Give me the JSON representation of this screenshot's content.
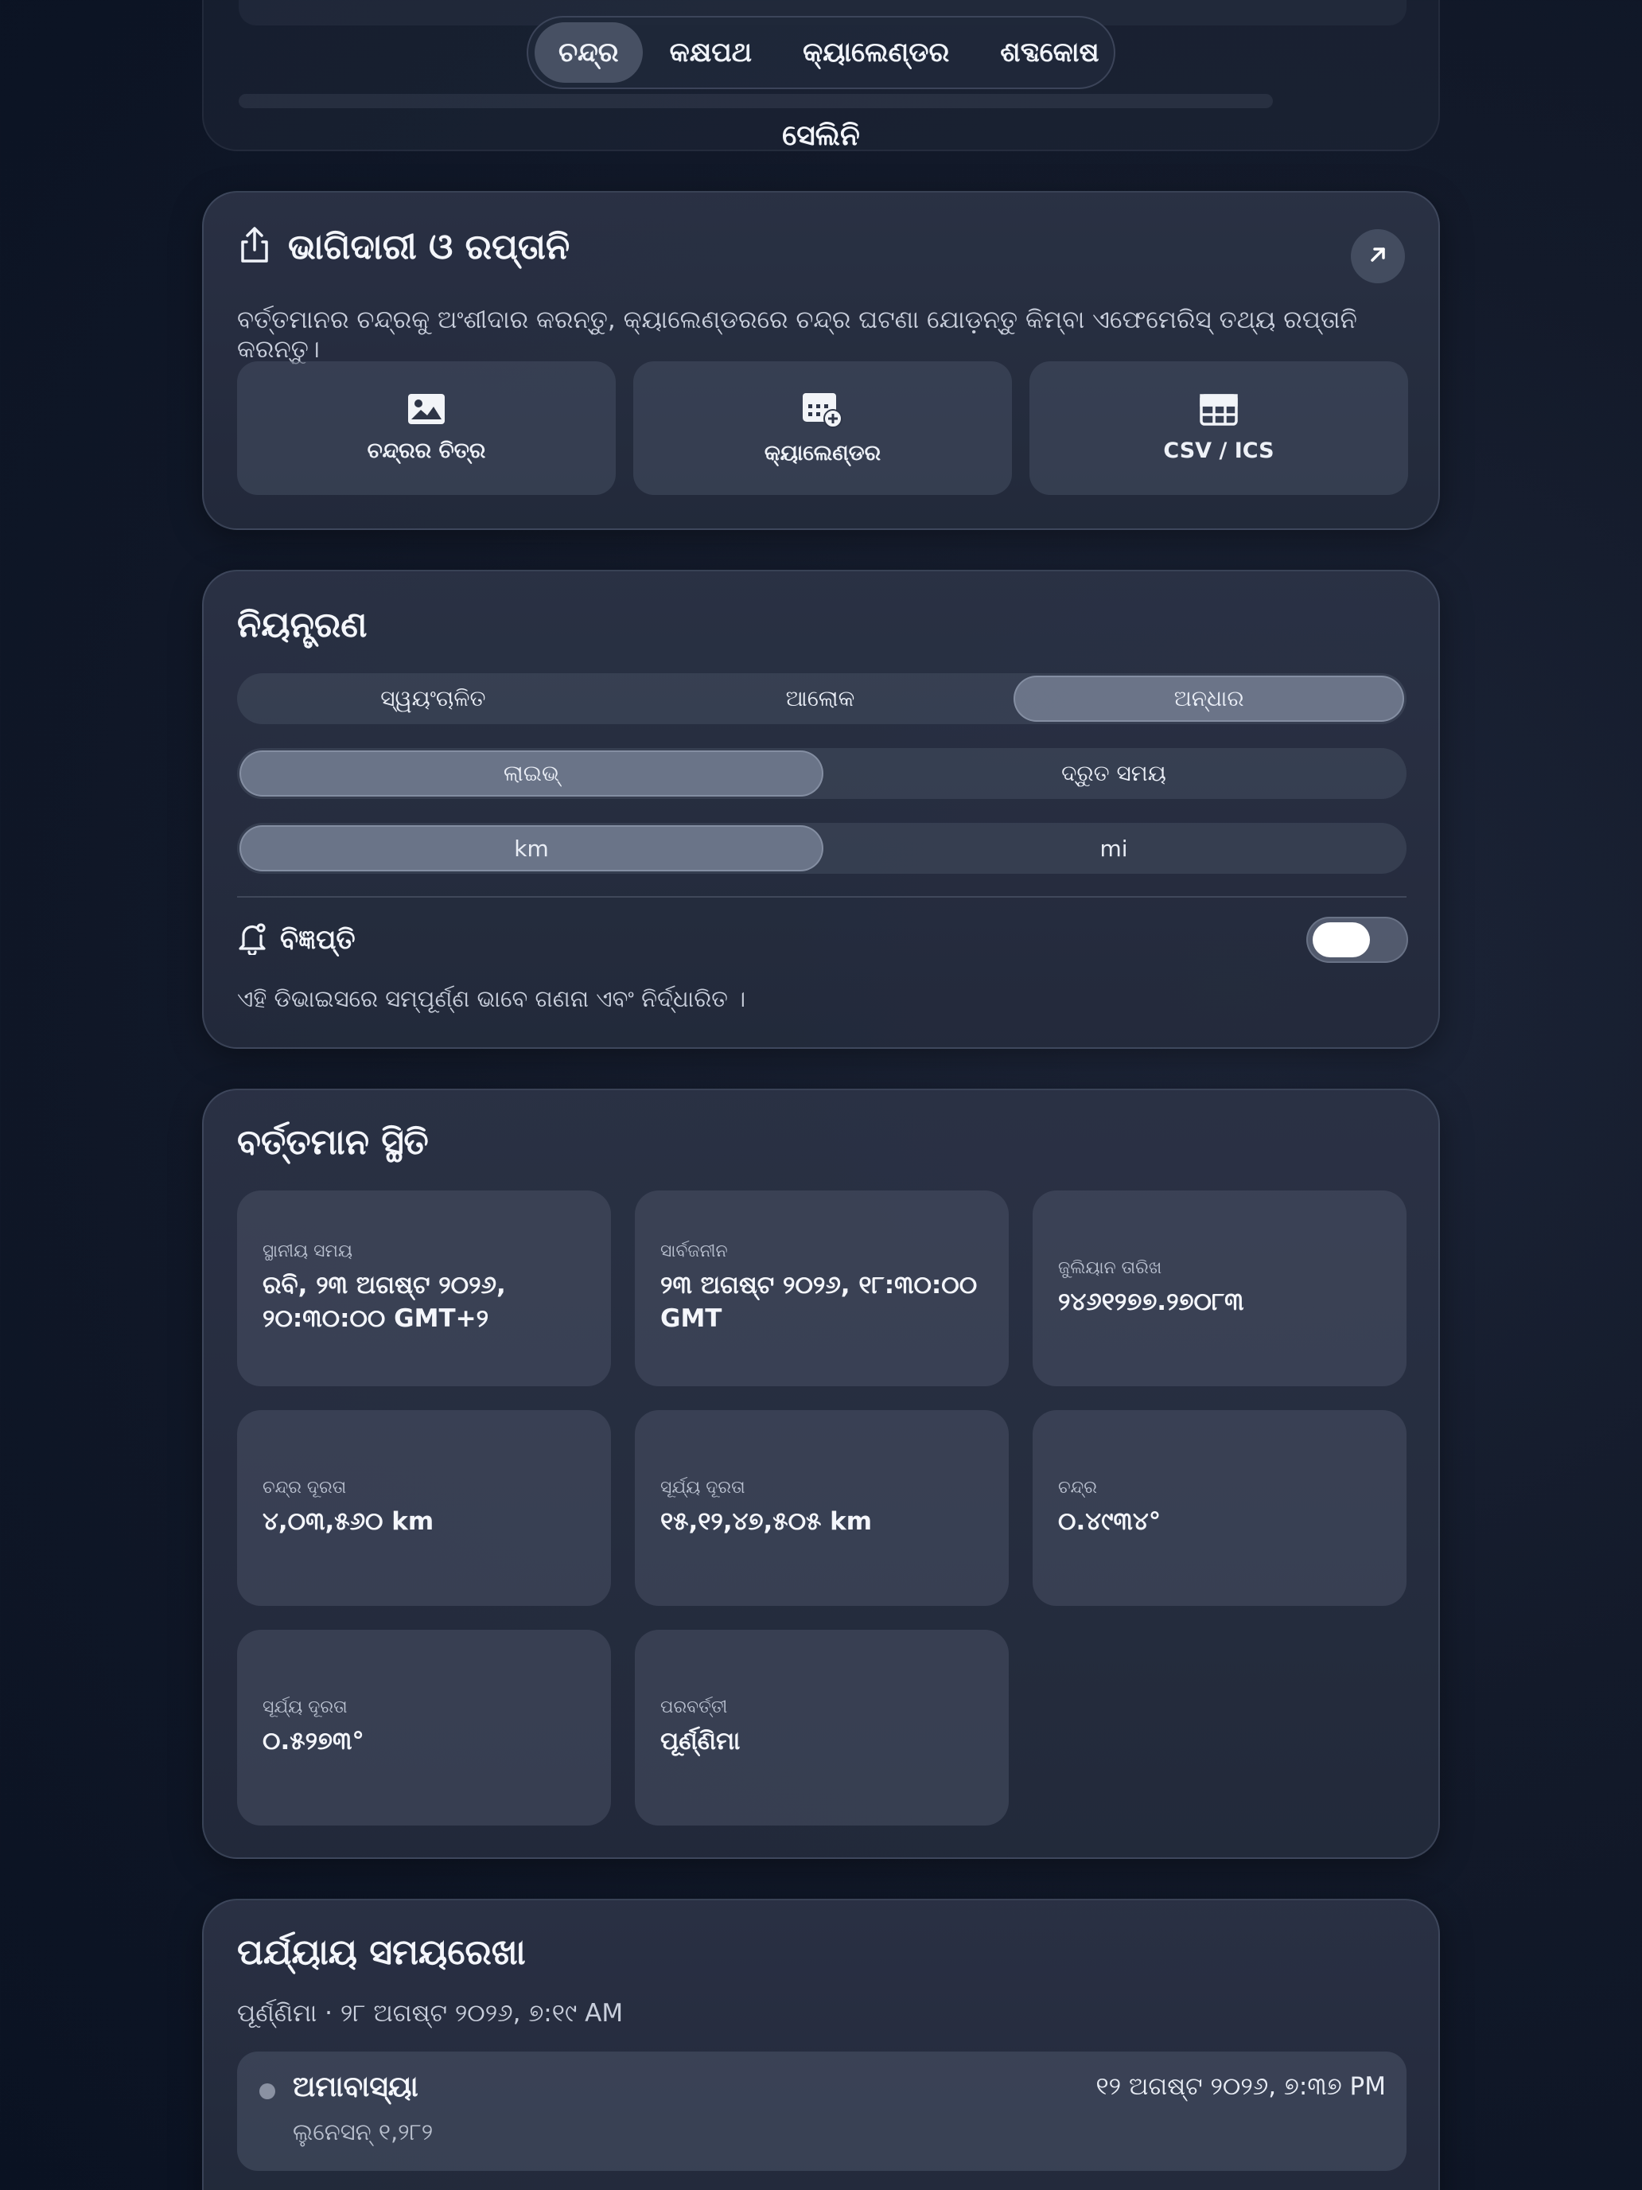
{
  "nav": {
    "tabs": [
      {
        "label": "ଚନ୍ଦ୍ର",
        "active": true
      },
      {
        "label": "କକ୍ଷପଥ",
        "active": false
      },
      {
        "label": "କ୍ୟାଲେଣ୍ଡର",
        "active": false
      },
      {
        "label": "ଶବ୍ଦକୋଷ",
        "active": false
      }
    ]
  },
  "app_title": "ସେଲିନି",
  "share": {
    "title": "ଭାଗିଦାରୀ ଓ ରପ୍ତାନି",
    "description": "ବର୍ତ୍ତମାନର ଚନ୍ଦ୍ରକୁ ଅଂଶୀଦାର କରନ୍ତୁ, କ୍ୟାଲେଣ୍ଡରରେ ଚନ୍ଦ୍ର ଘଟଣା ଯୋଡ଼ନ୍ତୁ କିମ୍ବା ଏଫେମେରିସ୍ ତଥ୍ୟ ରପ୍ତାନି କରନ୍ତୁ।",
    "tiles": [
      {
        "label": "ଚନ୍ଦ୍ରର ଚିତ୍ର",
        "icon": "image-icon"
      },
      {
        "label": "କ୍ୟାଲେଣ୍ଡର",
        "icon": "calendar-add-icon"
      },
      {
        "label": "CSV / ICS",
        "icon": "table-icon"
      }
    ]
  },
  "controls": {
    "title": "ନିୟନ୍ତ୍ରଣ",
    "theme": {
      "options": [
        "ସ୍ୱୟଂଚାଳିତ",
        "ଆଲୋକ",
        "ଅନ୍ଧାର"
      ],
      "selected": "ଅନ୍ଧାର"
    },
    "mode": {
      "options": [
        "ଲାଇଭ୍",
        "ଦ୍ରୁତ ସମୟ"
      ],
      "selected": "ଲାଇଭ୍"
    },
    "units": {
      "options": [
        "km",
        "mi"
      ],
      "selected": "km"
    },
    "notifications": {
      "label": "ବିଜ୍ଞପ୍ତି",
      "enabled": false
    },
    "note": "ଏହି ଡିଭାଇସରେ ସମ୍ପୂର୍ଣ୍ଣ ଭାବେ ଗଣନା ଏବଂ ନିର୍ଦ୍ଧାରିତ ।"
  },
  "status": {
    "title": "ବର୍ତ୍ତମାନ ସ୍ଥିତି",
    "items": [
      {
        "label": "ସ୍ଥାନୀୟ ସମୟ",
        "value": "ରବି, ୨୩ ଅଗଷ୍ଟ ୨୦୨୬, ୨୦:୩୦:୦୦ GMT+୨"
      },
      {
        "label": "ସାର୍ବଜନୀନ",
        "value": "୨୩ ଅଗଷ୍ଟ ୨୦୨୬, ୧୮:୩୦:୦୦ GMT"
      },
      {
        "label": "ଜୁଲିୟାନ ତାରିଖ",
        "value": "୨୪୬୧୨୭୭.୨୭୦୮୩"
      },
      {
        "label": "ଚନ୍ଦ୍ର ଦୂରତା",
        "value": "୪,୦୩,୫୬୦ km"
      },
      {
        "label": "ସୂର୍ଯ୍ୟ ଦୂରତା",
        "value": "୧୫,୧୨,୪୭,୫୦୫ km"
      },
      {
        "label": "ଚନ୍ଦ୍ର",
        "value": "୦.୪୯୩୪°"
      },
      {
        "label": "ସୂର୍ଯ୍ୟ ଦୂରତା",
        "value": "୦.୫୨୭୩°"
      },
      {
        "label": "ପରବର୍ତ୍ତୀ",
        "value": "ପୂର୍ଣ୍ଣିମା"
      }
    ]
  },
  "timeline": {
    "title": "ପର୍ଯ୍ୟାୟ ସମୟରେଖା",
    "subtitle": "ପୂର୍ଣ୍ଣିମା · ୨୮ ଅଗଷ୍ଟ ୨୦୨୬, ୭:୧୯ AM",
    "events": [
      {
        "name": "ଅମାବାସ୍ୟା",
        "sub": "ଲୁନେସନ୍ ୧,୨୮୨",
        "date": "୧୨ ଅଗଷ୍ଟ ୨୦୨୬, ୭:୩୭ PM"
      }
    ]
  },
  "colors": {
    "accent_active": "#6b7387",
    "card_bg": "#2b3245",
    "page_bg": "#0c1424"
  }
}
